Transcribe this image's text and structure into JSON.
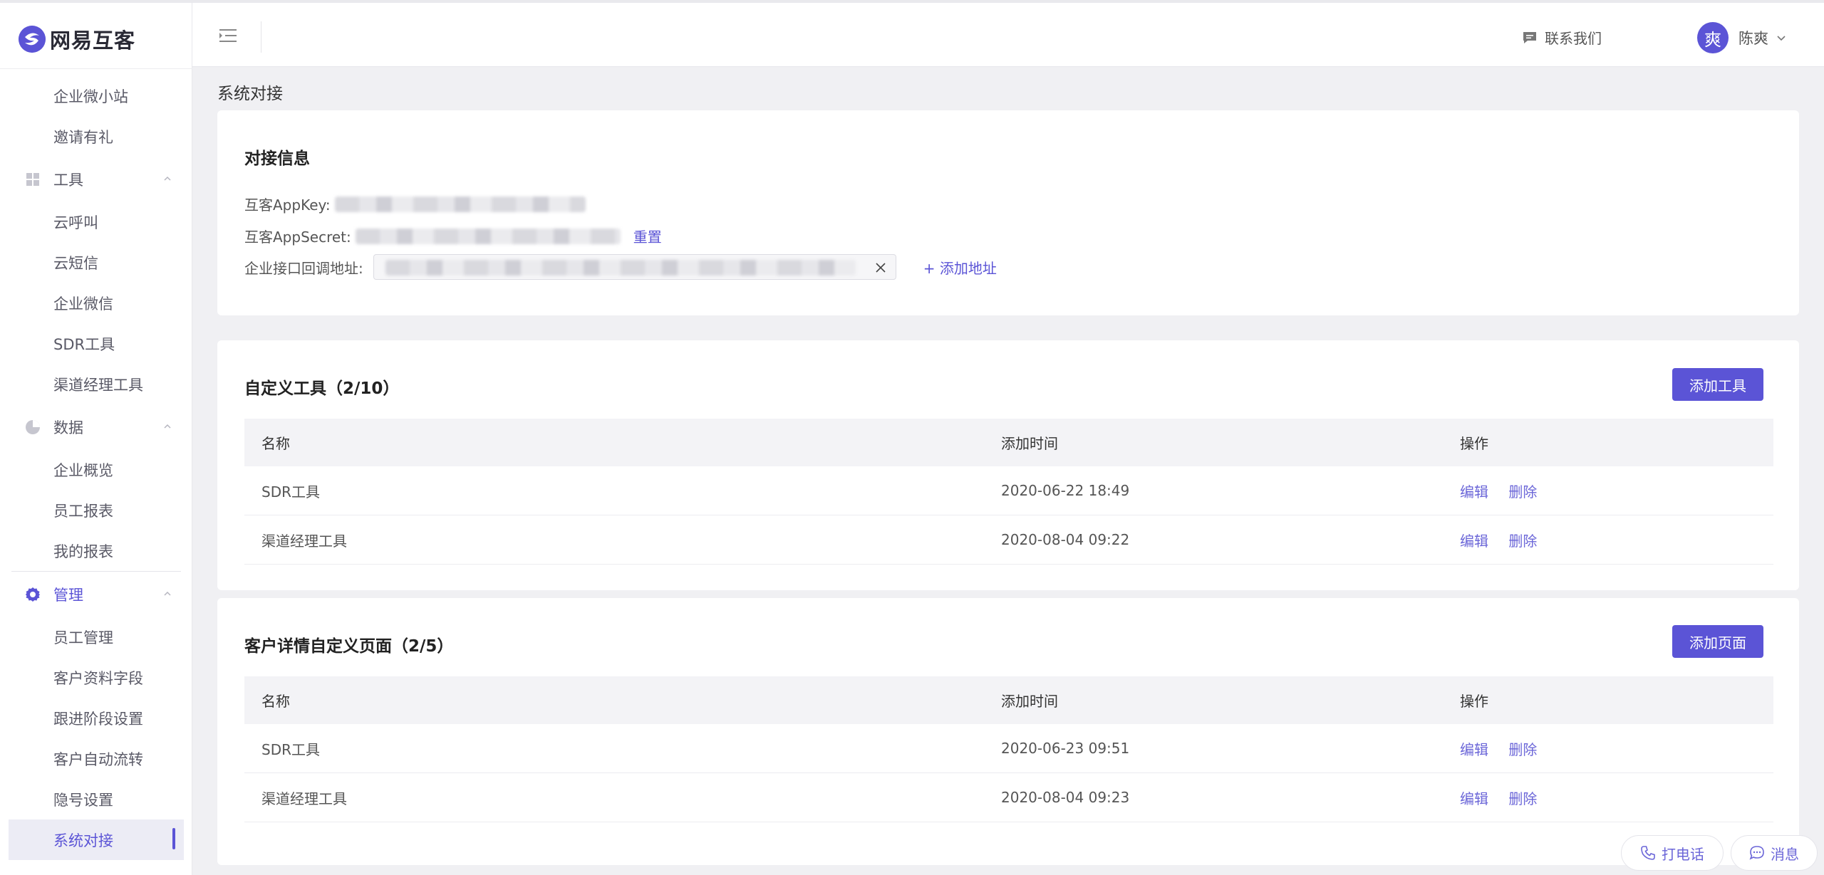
{
  "app": {
    "logo_glyph": "S",
    "logo_text": "网易互客",
    "accent": "#5b54d6"
  },
  "sidebar": {
    "items_top": [
      {
        "label": "企业微小站"
      },
      {
        "label": "邀请有礼"
      }
    ],
    "group_tools": {
      "label": "工具",
      "icon": "grid-icon"
    },
    "tools_items": [
      {
        "label": "云呼叫"
      },
      {
        "label": "云短信"
      },
      {
        "label": "企业微信"
      },
      {
        "label": "SDR工具"
      },
      {
        "label": "渠道经理工具"
      }
    ],
    "group_data": {
      "label": "数据",
      "icon": "pie-chart-icon"
    },
    "data_items": [
      {
        "label": "企业概览"
      },
      {
        "label": "员工报表"
      },
      {
        "label": "我的报表"
      }
    ],
    "group_manage": {
      "label": "管理",
      "icon": "gear-icon"
    },
    "manage_items": [
      {
        "label": "员工管理"
      },
      {
        "label": "客户资料字段"
      },
      {
        "label": "跟进阶段设置"
      },
      {
        "label": "客户自动流转"
      },
      {
        "label": "隐号设置"
      },
      {
        "label": "系统对接"
      }
    ]
  },
  "header": {
    "contact_label": "联系我们",
    "user_avatar_text": "爽",
    "user_name": "陈爽"
  },
  "page": {
    "title": "系统对接",
    "integration": {
      "title": "对接信息",
      "appkey_label": "互客AppKey:",
      "appsecret_label": "互客AppSecret:",
      "reset_label": "重置",
      "callback_label": "企业接口回调地址:",
      "add_address_label": "+ 添加地址"
    },
    "custom_tools": {
      "title": "自定义工具（2/10）",
      "add_button": "添加工具",
      "columns": [
        "名称",
        "添加时间",
        "操作"
      ],
      "rows": [
        {
          "name": "SDR工具",
          "time": "2020-06-22 18:49",
          "edit": "编辑",
          "delete": "删除"
        },
        {
          "name": "渠道经理工具",
          "time": "2020-08-04 09:22",
          "edit": "编辑",
          "delete": "删除"
        }
      ]
    },
    "custom_pages": {
      "title": "客户详情自定义页面（2/5）",
      "add_button": "添加页面",
      "columns": [
        "名称",
        "添加时间",
        "操作"
      ],
      "rows": [
        {
          "name": "SDR工具",
          "time": "2020-06-23 09:51",
          "edit": "编辑",
          "delete": "删除"
        },
        {
          "name": "渠道经理工具",
          "time": "2020-08-04 09:23",
          "edit": "编辑",
          "delete": "删除"
        }
      ]
    }
  },
  "floating": {
    "call_label": "打电话",
    "message_label": "消息"
  }
}
